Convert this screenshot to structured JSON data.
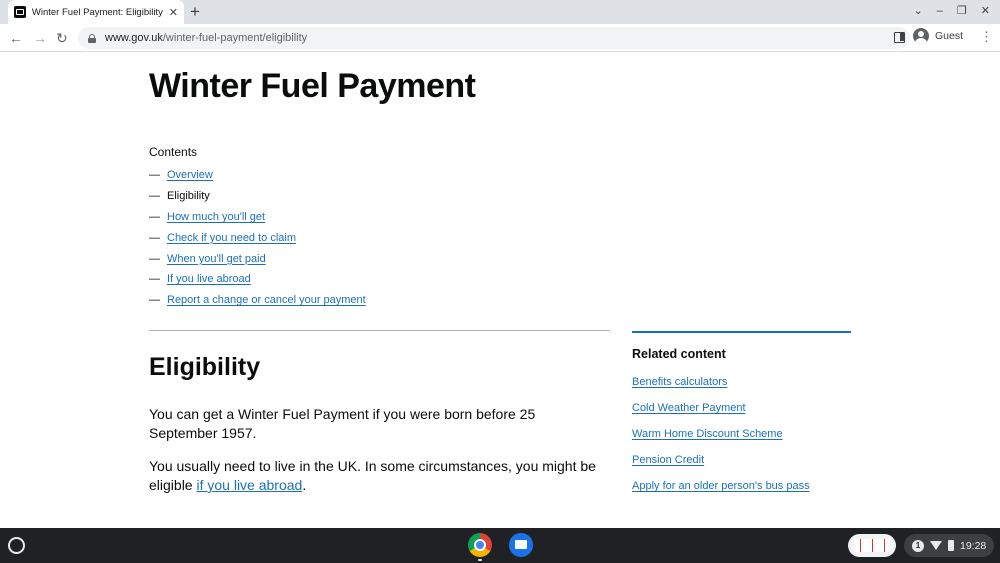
{
  "browser": {
    "tab_title": "Winter Fuel Payment: Eligibility",
    "url_host": "www.gov.uk",
    "url_path": "/winter-fuel-payment/eligibility",
    "profile_label": "Guest"
  },
  "page": {
    "title": "Winter Fuel Payment",
    "contents_label": "Contents",
    "toc": [
      "Overview",
      "Eligibility",
      "How much you'll get",
      "Check if you need to claim",
      "When you'll get paid",
      "If you live abroad",
      "Report a change or cancel your payment"
    ],
    "section_title": "Eligibility",
    "para1": "You can get a Winter Fuel Payment if you were born before 25 September 1957.",
    "para2_prefix": "You usually need to live in the UK. In some circumstances, you might be eligible ",
    "para2_link": "if you live abroad",
    "para2_suffix": "."
  },
  "related": {
    "title": "Related content",
    "items": [
      "Benefits calculators",
      "Cold Weather Payment",
      "Warm Home Discount Scheme",
      "Pension Credit",
      "Apply for an older person's bus pass"
    ]
  },
  "shelf": {
    "notification_count": "1",
    "time": "19:28"
  },
  "colors": {
    "link": "#1d70b8",
    "text": "#0b0c0c",
    "shelf": "#202124"
  }
}
